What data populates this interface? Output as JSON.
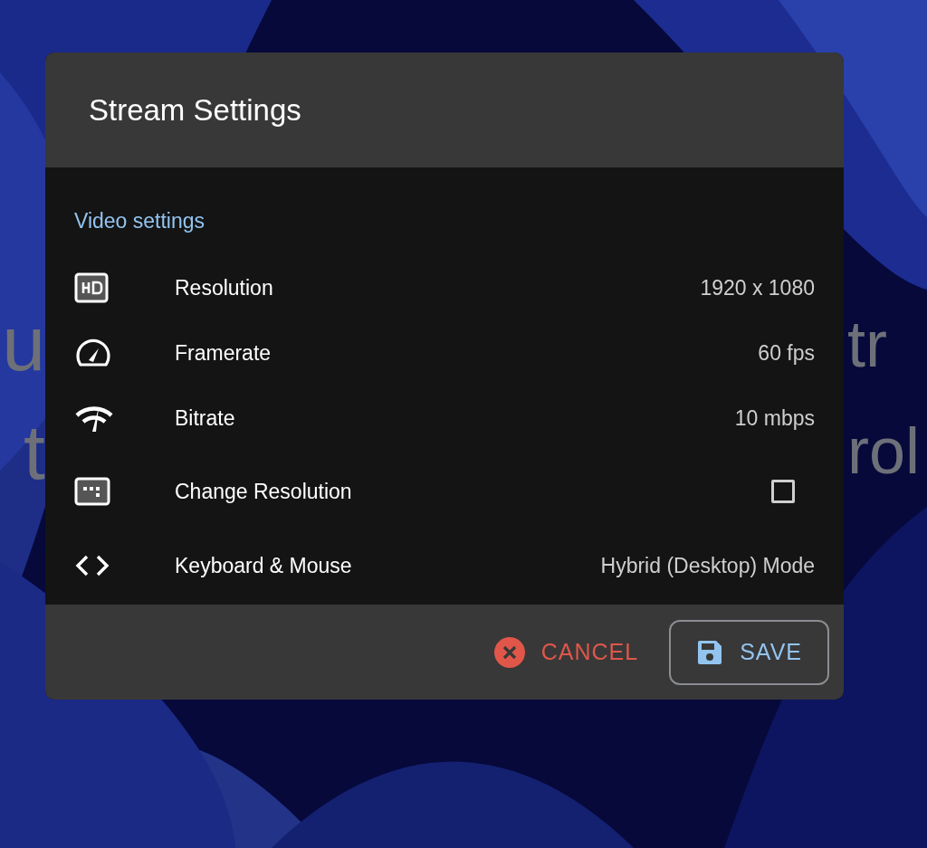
{
  "background_text": {
    "left": [
      "u",
      "t"
    ],
    "right": [
      "tr",
      "rol"
    ]
  },
  "dialog": {
    "title": "Stream Settings",
    "section": "Video settings",
    "rows": [
      {
        "kind": "value",
        "label": "Resolution",
        "value": "1920 x 1080"
      },
      {
        "kind": "value",
        "label": "Framerate",
        "value": "60 fps"
      },
      {
        "kind": "value",
        "label": "Bitrate",
        "value": "10 mbps"
      },
      {
        "kind": "checkbox",
        "label": "Change Resolution",
        "checked": false
      },
      {
        "kind": "value",
        "label": "Keyboard & Mouse",
        "value": "Hybrid (Desktop) Mode"
      }
    ],
    "buttons": [
      {
        "kind": "cancel",
        "label": "CANCEL"
      },
      {
        "kind": "save",
        "label": "SAVE"
      }
    ]
  }
}
